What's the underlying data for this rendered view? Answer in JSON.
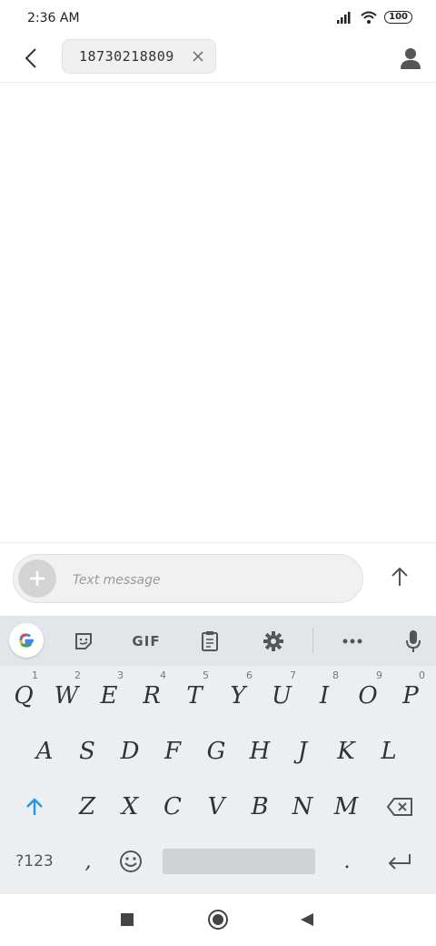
{
  "status_bar": {
    "time": "2:36 AM",
    "battery": "100"
  },
  "header": {
    "recipient": "18730218809"
  },
  "compose": {
    "placeholder": "Text message"
  },
  "keyboard": {
    "toolbar": {
      "gif": "GIF"
    },
    "row1": [
      {
        "label": "Q",
        "hint": "1"
      },
      {
        "label": "W",
        "hint": "2"
      },
      {
        "label": "E",
        "hint": "3"
      },
      {
        "label": "R",
        "hint": "4"
      },
      {
        "label": "T",
        "hint": "5"
      },
      {
        "label": "Y",
        "hint": "6"
      },
      {
        "label": "U",
        "hint": "7"
      },
      {
        "label": "I",
        "hint": "8"
      },
      {
        "label": "O",
        "hint": "9"
      },
      {
        "label": "P",
        "hint": "0"
      }
    ],
    "row2": [
      "A",
      "S",
      "D",
      "F",
      "G",
      "H",
      "J",
      "K",
      "L"
    ],
    "row3": [
      "Z",
      "X",
      "C",
      "V",
      "B",
      "N",
      "M"
    ],
    "symbols_key": "?123",
    "comma": ",",
    "period": "."
  },
  "icons": {
    "back": "back-arrow-icon",
    "contact": "person-icon",
    "chip_close": "close-icon",
    "add": "plus-icon",
    "send": "arrow-up-icon",
    "shift": "shift-icon",
    "backspace": "backspace-icon",
    "emoji": "emoji-icon",
    "enter": "enter-icon",
    "sticker": "sticker-icon",
    "clipboard": "clipboard-icon",
    "settings": "gear-icon",
    "more": "more-icon",
    "mic": "mic-icon",
    "google": "google-icon"
  },
  "colors": {
    "shift_accent": "#2196f3",
    "keyboard_bg": "#eceff1"
  }
}
